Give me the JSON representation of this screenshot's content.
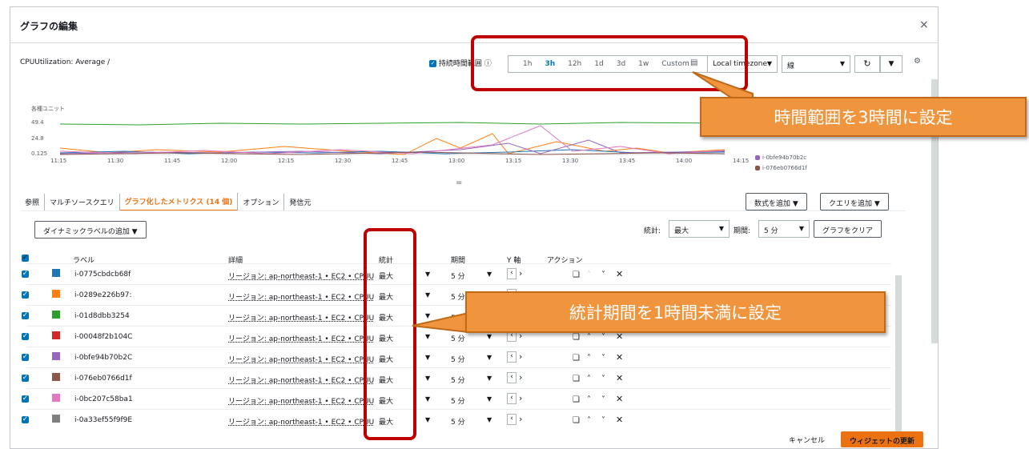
{
  "modal": {
    "title": "グラフの編集",
    "close": "×"
  },
  "graph": {
    "metric_title": "CPUUtilization: Average",
    "persist_label": "持続時間範囲",
    "ranges": [
      "1h",
      "3h",
      "12h",
      "1d",
      "3d",
      "1w",
      "Custom"
    ],
    "active_range": "3h",
    "timezone": "Local timezone",
    "chart_type": "線",
    "y_unit": "各種ユニット",
    "y_ticks": [
      "49.4",
      "24.8",
      "0.125"
    ],
    "x_ticks": [
      "11:15",
      "11:30",
      "11:45",
      "12:00",
      "12:15",
      "12:30",
      "12:45",
      "13:00",
      "13:15",
      "13:30",
      "13:45",
      "14:00",
      "14:15"
    ],
    "legend": [
      {
        "name": "i-0bfe94b70b2c",
        "color": "#9467bd"
      },
      {
        "name": "i-076eb0766d1f",
        "color": "#8c564b"
      }
    ]
  },
  "colors": {
    "accent": "#ec7211",
    "link": "#0073bb",
    "annot_red": "#c00000",
    "callout": "#f0953e"
  },
  "tabs": [
    "参照",
    "マルチソースクエリ",
    "グラフ化したメトリクス (14 個)",
    "オプション",
    "発信元"
  ],
  "toolbar": {
    "add_formula": "数式を追加 ▼",
    "add_query": "クエリを追加 ▼",
    "dynamic_label": "ダイナミックラベルの追加 ▼",
    "stat_label": "統計:",
    "stat_value": "最大",
    "period_label": "期間:",
    "period_value": "5 分",
    "clear_graph": "グラフをクリア"
  },
  "table": {
    "headers": {
      "label": "ラベル",
      "details": "詳細",
      "stat": "統計",
      "period": "期間",
      "yaxis": "Y 軸",
      "actions": "アクション"
    },
    "rows": [
      {
        "label": "i-0775cbdcb68f",
        "color": "#1f77b4",
        "details": "リージョン: ap-northeast-1 • EC2 • CPUU",
        "stat": "最大",
        "period": "5 分"
      },
      {
        "label": "i-0289e226b97:",
        "color": "#ff7f0e",
        "details": "リージョン: ap-northeast-1 • EC2 • CPUU",
        "stat": "最大",
        "period": "5 分"
      },
      {
        "label": "i-01d8dbb3254",
        "color": "#2ca02c",
        "details": "リージョン: ap-northeast-1 • EC2 • CPUU",
        "stat": "最大",
        "period": "5 分"
      },
      {
        "label": "i-00048f2b104C",
        "color": "#d62728",
        "details": "リージョン: ap-northeast-1 • EC2 • CPUU",
        "stat": "最大",
        "period": "5 分"
      },
      {
        "label": "i-0bfe94b70b2C",
        "color": "#9467bd",
        "details": "リージョン: ap-northeast-1 • EC2 • CPUU",
        "stat": "最大",
        "period": "5 分"
      },
      {
        "label": "i-076eb0766d1f",
        "color": "#8c564b",
        "details": "リージョン: ap-northeast-1 • EC2 • CPUU",
        "stat": "最大",
        "period": "5 分"
      },
      {
        "label": "i-0bc207c58ba1",
        "color": "#e377c2",
        "details": "リージョン: ap-northeast-1 • EC2 • CPUU",
        "stat": "最大",
        "period": "5 分"
      },
      {
        "label": "i-0a33ef55f9f9E",
        "color": "#7f7f7f",
        "details": "リージョン: ap-northeast-1 • EC2 • CPUU",
        "stat": "最大",
        "period": "5 分"
      }
    ]
  },
  "footer": {
    "cancel": "キャンセル",
    "update": "ウィジェットの更新"
  },
  "annotations": {
    "time_callout": "時間範囲を3時間に設定",
    "stat_callout": "統計期間を1時間未満に設定"
  }
}
